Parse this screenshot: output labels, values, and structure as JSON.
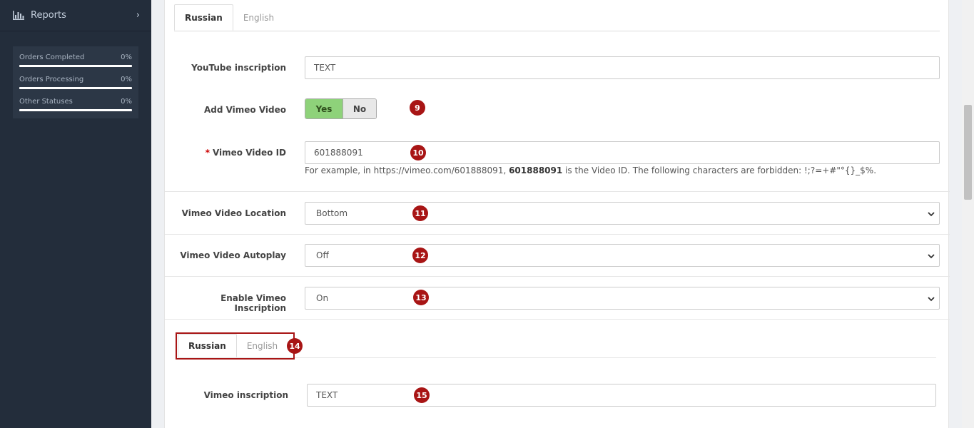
{
  "sidebar": {
    "reports_label": "Reports",
    "stats": [
      {
        "label": "Orders Completed",
        "value": "0%"
      },
      {
        "label": "Orders Processing",
        "value": "0%"
      },
      {
        "label": "Other Statuses",
        "value": "0%"
      }
    ]
  },
  "top_tabs": [
    {
      "label": "Russian"
    },
    {
      "label": "English"
    }
  ],
  "youtube_inscription": {
    "label": "YouTube inscription",
    "value": "TEXT"
  },
  "add_vimeo": {
    "label": "Add Vimeo Video",
    "yes": "Yes",
    "no": "No",
    "selected": "Yes"
  },
  "vimeo_id": {
    "label": "Vimeo Video ID",
    "required_mark": "*",
    "value": "601888091",
    "help_prefix": "For example, in https://vimeo.com/601888091, ",
    "help_bold": "601888091",
    "help_suffix": " is the Video ID. The following characters are forbidden: !;?=+#\"°{}_$%."
  },
  "vimeo_location": {
    "label": "Vimeo Video Location",
    "value": "Bottom"
  },
  "vimeo_autoplay": {
    "label": "Vimeo Video Autoplay",
    "value": "Off"
  },
  "vimeo_inscription_enable": {
    "label": "Enable Vimeo Inscription",
    "value": "On"
  },
  "inner_tabs": [
    {
      "label": "Russian"
    },
    {
      "label": "English"
    }
  ],
  "vimeo_inscription": {
    "label": "Vimeo inscription",
    "value": "TEXT"
  },
  "badges": [
    "9",
    "10",
    "11",
    "12",
    "13",
    "14",
    "15"
  ],
  "colors": {
    "sidebar_bg": "#232d3b",
    "badge": "#a81515",
    "toggle_yes": "#8ed27a"
  }
}
